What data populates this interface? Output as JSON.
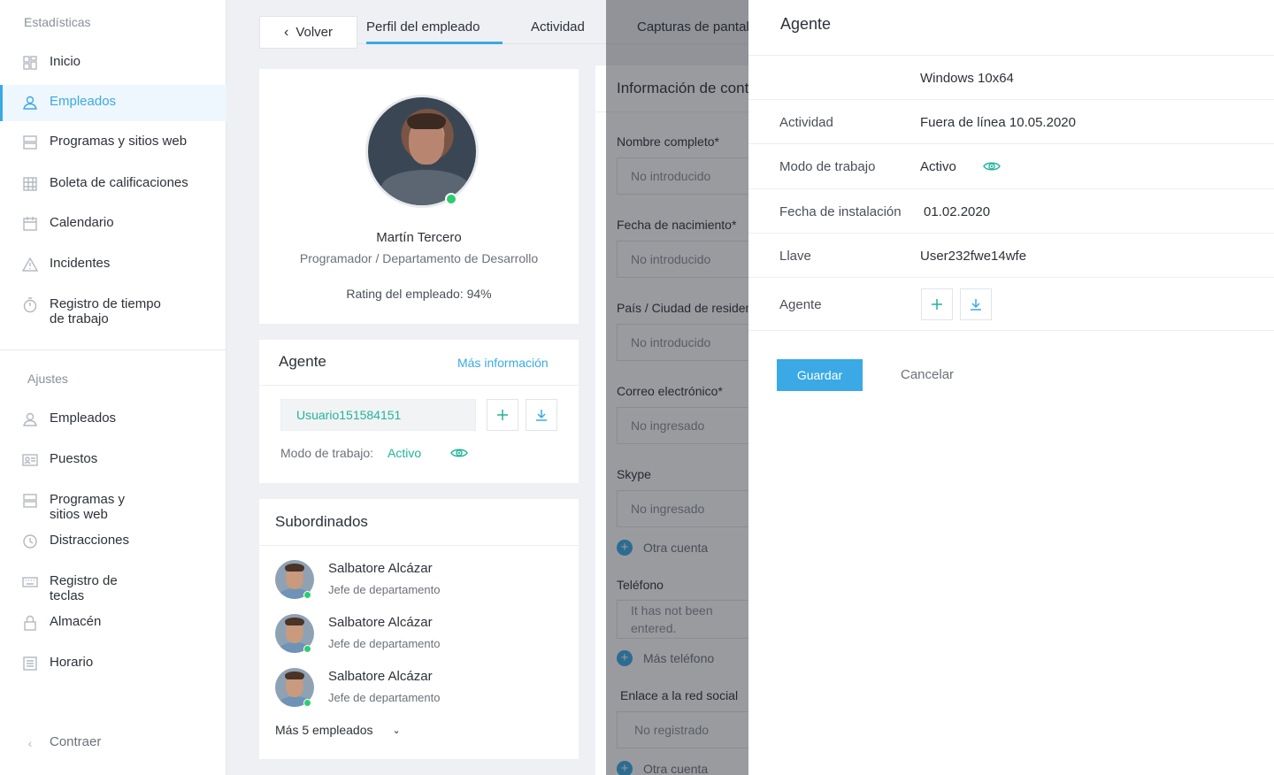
{
  "sidebar": {
    "stats_title": "Estadísticas",
    "stats_items": [
      {
        "label": "Inicio",
        "icon": "dashboard-icon"
      },
      {
        "label": "Empleados",
        "icon": "user-icon"
      },
      {
        "label": "Programas y sitios web",
        "icon": "server-icon"
      },
      {
        "label": "Boleta de calificaciones",
        "icon": "grid-icon"
      },
      {
        "label": "Calendario",
        "icon": "calendar-icon"
      },
      {
        "label": "Incidentes",
        "icon": "warning-icon"
      },
      {
        "label": "Registro de tiempo",
        "label2": "de trabajo",
        "icon": "stopwatch-icon"
      }
    ],
    "settings_title": "Ajustes",
    "settings_items": [
      {
        "label": "Empleados",
        "icon": "user-icon"
      },
      {
        "label": "Puestos",
        "icon": "id-card-icon"
      },
      {
        "label": "Programas y",
        "label2": "sitios web",
        "icon": "server-icon"
      },
      {
        "label": "Distracciones",
        "icon": "timer-icon"
      },
      {
        "label": "Registro de",
        "label2": "teclas",
        "icon": "keyboard-icon"
      },
      {
        "label": "Almacén",
        "icon": "lock-icon"
      },
      {
        "label": "Horario",
        "icon": "list-icon"
      }
    ],
    "collapse_label": "Contraer"
  },
  "nav": {
    "back_label": "Volver",
    "tabs": [
      "Perfil del empleado",
      "Actividad",
      "Capturas de pantalla"
    ]
  },
  "profile": {
    "name": "Martín Tercero",
    "role": "Programador / Departamento de Desarrollo",
    "rating": "Rating del empleado: 94%"
  },
  "agent_card": {
    "title": "Agente",
    "more_link": "Más información",
    "username": "Usuario151584151",
    "work_mode_label": "Modo de trabajo:",
    "work_mode_value": "Activo"
  },
  "subordinates": {
    "title": "Subordinados",
    "items": [
      {
        "name": "Salbatore Alcázar",
        "role": "Jefe de departamento"
      },
      {
        "name": "Salbatore Alcázar",
        "role": "Jefe de departamento"
      },
      {
        "name": "Salbatore Alcázar",
        "role": "Jefe de departamento"
      }
    ],
    "more_label": "Más 5 empleados"
  },
  "contact_info": {
    "title": "Información de contacto",
    "fields": [
      {
        "label": "Nombre completo*",
        "value": "No introducido"
      },
      {
        "label": "Fecha de nacimiento*",
        "value": "No introducido"
      },
      {
        "label": "País / Ciudad de residencia",
        "value": "No introducido"
      },
      {
        "label": "Correo electrónico*",
        "value": "No ingresado"
      },
      {
        "label": "Skype",
        "value": "No ingresado"
      }
    ],
    "other_account": "Otra cuenta",
    "phone_label": "Teléfono",
    "phone_value": "It has not been entered.",
    "more_phone": "Más teléfono",
    "social_label": "Enlace a la red social",
    "social_value": "No registrado",
    "other_account2": "Otra cuenta"
  },
  "panel": {
    "title": "Agente",
    "os_value": "Windows 10x64",
    "rows": [
      {
        "label": "Actividad",
        "value": "Fuera de línea 10.05.2020"
      },
      {
        "label": "Modo de trabajo",
        "value": "Activo"
      },
      {
        "label": "Fecha de instalación",
        "value": "01.02.2020"
      },
      {
        "label": "Llave",
        "value": "User232fwe14wfe"
      },
      {
        "label": "Agente",
        "value": ""
      }
    ],
    "save_label": "Guardar",
    "cancel_label": "Cancelar"
  },
  "colors": {
    "accent": "#3aa9e6",
    "green": "#22b49a",
    "online": "#2ecc71"
  }
}
